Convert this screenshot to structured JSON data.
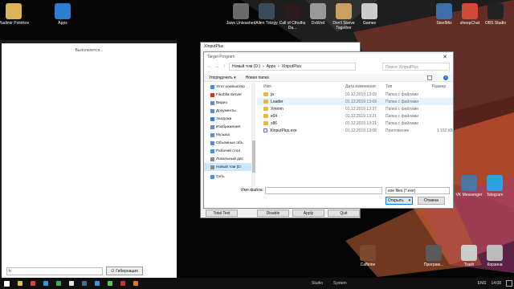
{
  "desktop": {
    "icons_top": [
      {
        "label": "Vladimir Polnikov",
        "color": "#d9b25a"
      },
      {
        "label": "Apps",
        "color": "#2d7dd2"
      },
      {
        "label": "Jaws Unleashed",
        "color": "#6b6b6b"
      },
      {
        "label": "Alien Trilogy",
        "color": "#3a4b5a"
      },
      {
        "label": "Call of Cthulhu Da...",
        "color": "#2b1b1b"
      },
      {
        "label": "DxWnd",
        "color": "#999999"
      },
      {
        "label": "Don't Starve Together",
        "color": "#c8a060"
      },
      {
        "label": "Games",
        "color": "#cccccc"
      },
      {
        "label": "SteelMix",
        "color": "#3e6fa8"
      },
      {
        "label": "sheepChat",
        "color": "#d34a3a"
      },
      {
        "label": "OBS Studio",
        "color": "#222222"
      }
    ],
    "icons_right": [
      {
        "label": "VK Messenger",
        "color": "#4a76a8"
      },
      {
        "label": "Telegram",
        "color": "#2aa3e0"
      }
    ],
    "icons_bottom": [
      {
        "label": "Caffeine",
        "color": "#7a4a2a"
      },
      {
        "label": "Програм...",
        "color": "#5a5a5a"
      },
      {
        "label": "Trash",
        "color": "#cccccc"
      },
      {
        "label": "Корзина",
        "color": "#bbbbbb"
      }
    ]
  },
  "left_window": {
    "status_text": "Выполняется...",
    "input_value": "h",
    "hibernate_label": "Гибернация"
  },
  "back_window": {
    "title": "XInputPlus",
    "buttons": [
      "Total Test",
      "Disable",
      "Apply",
      "Quit"
    ]
  },
  "dialog": {
    "title": "Target Program",
    "path": [
      "Новый том (D:)",
      "Apps",
      "XInputPlus"
    ],
    "search_placeholder": "Поиск: XInputPlus",
    "toolbar": {
      "organize": "Упорядочить ▾",
      "new_folder": "Новая папка"
    },
    "nav_items": [
      {
        "label": "Этот компьютер",
        "color": "#4a8fd9"
      },
      {
        "label": "FileZilla Server",
        "color": "#c0392b"
      },
      {
        "label": "Видео",
        "color": "#6a8bb8"
      },
      {
        "label": "Документы",
        "color": "#6a8bb8"
      },
      {
        "label": "Загрузки",
        "color": "#2f7fd6"
      },
      {
        "label": "Изображения",
        "color": "#6a8bb8"
      },
      {
        "label": "Музыка",
        "color": "#6a8bb8"
      },
      {
        "label": "Объемные объ",
        "color": "#6a8bb8"
      },
      {
        "label": "Рабочий стол",
        "color": "#4a8fd9"
      },
      {
        "label": "Локальный дис",
        "color": "#8a8a8a"
      },
      {
        "label": "Новый том (D:",
        "color": "#8a8a8a"
      },
      {
        "label": "Сеть",
        "color": "#4a8fd9"
      }
    ],
    "columns": {
      "name": "Имя",
      "date": "Дата изменения",
      "type": "Тип",
      "size": "Размер"
    },
    "files": [
      {
        "name": "ja",
        "date": "01.12.2019 13:09",
        "type": "Папка с файлами",
        "size": "",
        "kind": "folder"
      },
      {
        "name": "Loader",
        "date": "01.12.2019 13:09",
        "type": "Папка с файлами",
        "size": "",
        "kind": "folder"
      },
      {
        "name": "Xmmm",
        "date": "01.12.2019 13:27",
        "type": "Папка с файлами",
        "size": "",
        "kind": "folder"
      },
      {
        "name": "x64",
        "date": "01.12.2019 13:21",
        "type": "Папка с файлами",
        "size": "",
        "kind": "folder"
      },
      {
        "name": "x86",
        "date": "01.12.2019 13:21",
        "type": "Папка с файлами",
        "size": "",
        "kind": "folder"
      },
      {
        "name": "XInputPlus.exe",
        "date": "01.12.2019 13:08",
        "type": "Приложение",
        "size": "1 152 КБ",
        "kind": "exe"
      }
    ],
    "filename_label": "Имя файла:",
    "filename_value": "",
    "filter_value": "exe files (*.exe)",
    "open_label": "Открыть",
    "cancel_label": "Отмена"
  },
  "taskbar": {
    "pinned": [
      {
        "name": "explorer",
        "color": "#e8c040"
      },
      {
        "name": "chrome",
        "color": "#dd4433"
      },
      {
        "name": "skype",
        "color": "#2a9fe0"
      },
      {
        "name": "media",
        "color": "#44aa55"
      },
      {
        "name": "store",
        "color": "#e5e5e5"
      },
      {
        "name": "steam",
        "color": "#3b6e9c"
      },
      {
        "name": "photoshop",
        "color": "#2f9fe0"
      },
      {
        "name": "app-green",
        "color": "#55cc55"
      },
      {
        "name": "app-red",
        "color": "#cc3333"
      },
      {
        "name": "app-orange",
        "color": "#e07a20"
      }
    ],
    "toolbars": [
      "Studio",
      "System"
    ],
    "lang": "ENG",
    "time": "14:08"
  }
}
